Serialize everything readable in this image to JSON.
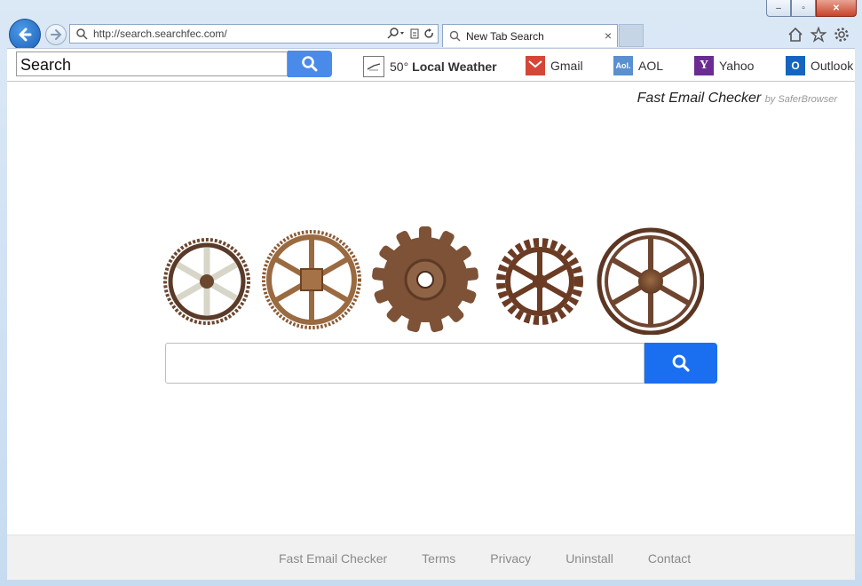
{
  "window": {
    "controls": [
      "–",
      "▫",
      "✕"
    ]
  },
  "address_bar": {
    "url": "http://search.searchfec.com/"
  },
  "tab": {
    "title": "New Tab Search",
    "close": "×"
  },
  "toolbar": {
    "search_value": "Search",
    "items": [
      {
        "label_prefix": "50°",
        "label": "Local Weather",
        "icon": "weather-icon"
      },
      {
        "label": "Gmail",
        "icon": "gmail-icon",
        "color": "#d44638"
      },
      {
        "label": "AOL",
        "icon_text": "Aol.",
        "icon": "aol-icon",
        "color": "#5a8fd0"
      },
      {
        "label": "Yahoo",
        "icon_text": "Y",
        "icon": "yahoo-icon",
        "color": "#6b2c91"
      },
      {
        "label": "Outlook",
        "icon_text": "O",
        "icon": "outlook-icon",
        "color": "#1565c0"
      }
    ]
  },
  "brand": {
    "name": "Fast Email Checker",
    "by": "by SaferBrowser"
  },
  "main_search": {
    "placeholder": "",
    "button_color": "#1a6ff0"
  },
  "footer": {
    "links": [
      "Fast Email Checker",
      "Terms",
      "Privacy",
      "Uninstall",
      "Contact"
    ]
  }
}
